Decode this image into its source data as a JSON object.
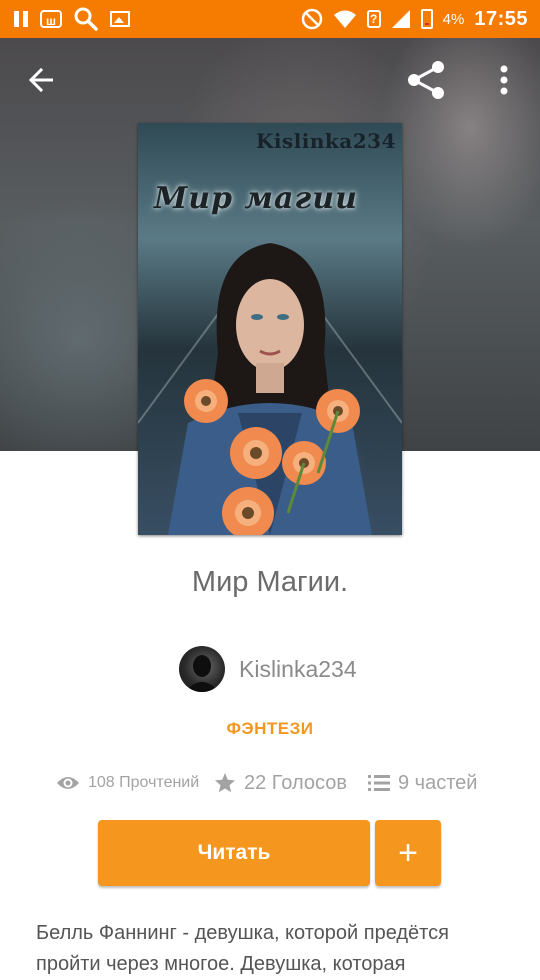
{
  "status_bar": {
    "time": "17:55",
    "battery": "4%",
    "left_icons": [
      "pause-icon",
      "w-app-icon",
      "search-icon",
      "image-icon"
    ],
    "right_icons": [
      "do-not-disturb-icon",
      "wifi-icon",
      "unknown-sim-icon",
      "signal-icon",
      "battery-icon"
    ]
  },
  "toolbar": {
    "back_icon": "arrow-left-icon",
    "share_icon": "share-icon",
    "more_icon": "more-vertical-icon"
  },
  "cover": {
    "author_mark": "Kislinka234",
    "title": "Мир магии"
  },
  "book": {
    "title": "Мир Магии.",
    "author": "Kislinka234",
    "genre": "ФЭНТЕЗИ"
  },
  "stats": {
    "reads": "108 Прочтений",
    "votes": "22 Голосов",
    "parts": "9 частей"
  },
  "actions": {
    "read_label": "Читать",
    "add_label": "+"
  },
  "description": "Белль Фаннинг - девушка, которой предётся пройти через многое. Девушка, которая",
  "colors": {
    "accent": "#f5961e",
    "status_bar": "#f57c00",
    "text_muted": "#a3a3a3"
  }
}
